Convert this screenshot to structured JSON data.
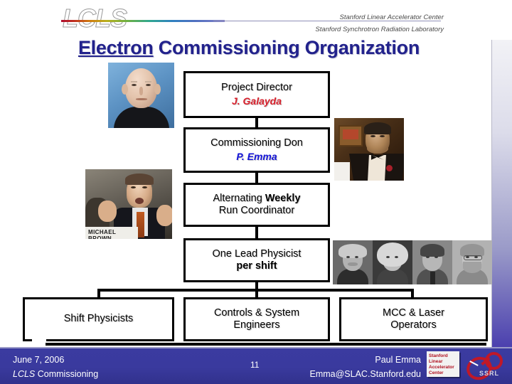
{
  "header": {
    "logo_text": "LCLS",
    "org_line_1": "Stanford Linear Accelerator Center",
    "org_line_2": "Stanford Synchrotron Radiation Laboratory"
  },
  "title": {
    "underlined_word": "Electron",
    "rest": " Commissioning Organization",
    "full": "Electron Commissioning Organization",
    "color": "#22228c"
  },
  "org_chart": {
    "nodes": [
      {
        "id": "director",
        "label": "Project Director",
        "person": "J. Galayda",
        "person_color": "#d8202c"
      },
      {
        "id": "commissioning-don",
        "label": "Commissioning Don",
        "person": "P. Emma",
        "person_color": "#1414d8"
      },
      {
        "id": "run-coordinator",
        "label_part_1": "Alternating ",
        "label_emphasis": "Weekly",
        "label_part_2": "Run Coordinator"
      },
      {
        "id": "lead-physicist",
        "label_part_1": "One Lead Physicist",
        "label_emphasis": "per shift"
      }
    ],
    "bottom_nodes": [
      {
        "id": "shift-physicists",
        "label": "Shift Physicists"
      },
      {
        "id": "controls-engineers",
        "line_1": "Controls & System",
        "line_2": "Engineers"
      },
      {
        "id": "mcc-laser-operators",
        "line_1": "MCC & Laser",
        "line_2": "Operators"
      }
    ]
  },
  "photos": [
    {
      "id": "galayda-photo",
      "caption": ""
    },
    {
      "id": "godfather-photo",
      "caption": ""
    },
    {
      "id": "michael-brown-photo",
      "nameplate": "MICHAEL BROWN"
    },
    {
      "id": "physicists-strip",
      "caption": ""
    }
  ],
  "footer": {
    "date": "June 7, 2006",
    "event_italic": "LCLS",
    "event_rest": " Commissioning",
    "page_number": "11",
    "author": "Paul Emma",
    "email": "Emma@SLAC.Stanford.edu",
    "logo": {
      "line_1": "Stanford",
      "line_2": "Linear",
      "line_3": "Accelerator",
      "line_4": "Center",
      "mark_text": "SSRL"
    },
    "background_color": "#3b3ba0"
  }
}
